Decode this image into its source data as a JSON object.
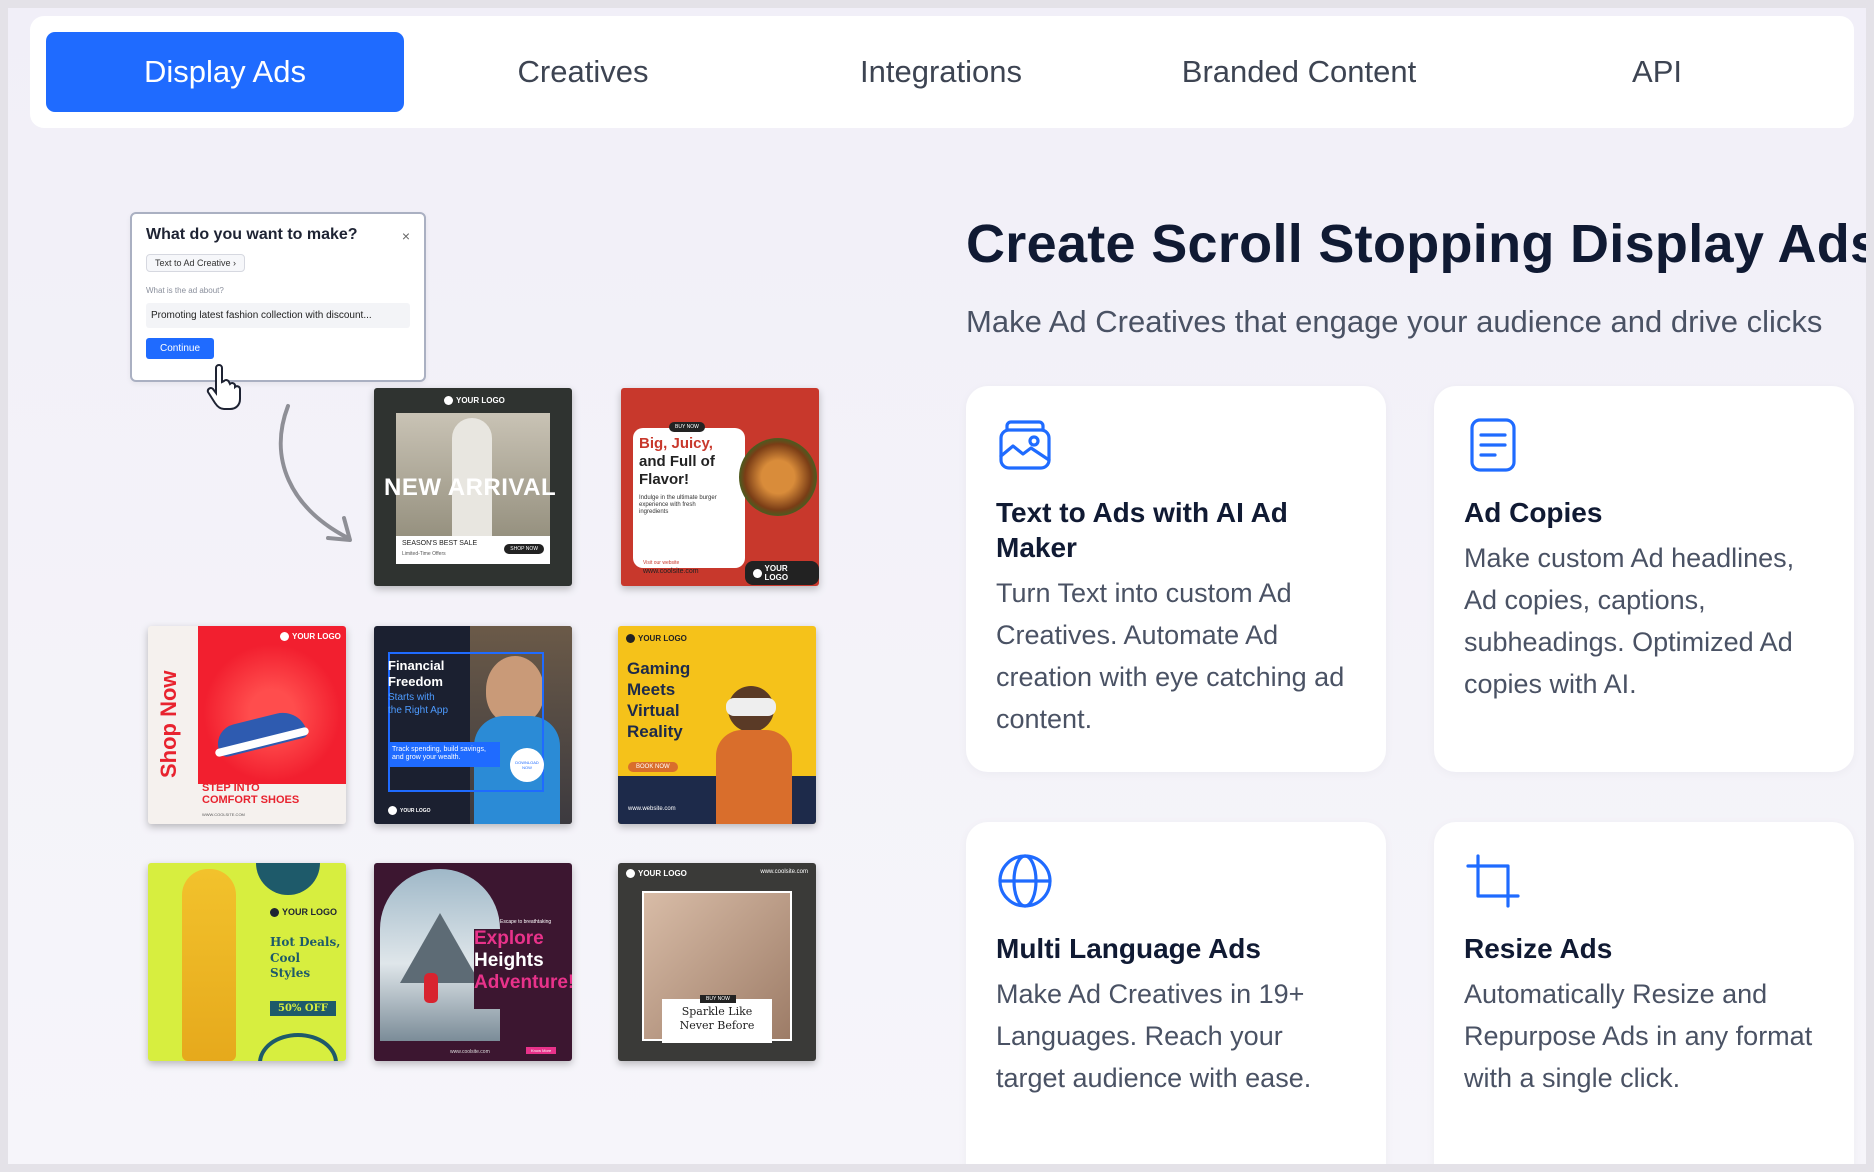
{
  "tabs": [
    {
      "label": "Display Ads",
      "active": true
    },
    {
      "label": "Creatives",
      "active": false
    },
    {
      "label": "Integrations",
      "active": false
    },
    {
      "label": "Branded Content",
      "active": false
    },
    {
      "label": "API",
      "active": false
    }
  ],
  "hero": {
    "title": "Create Scroll Stopping Display Ads",
    "subtitle": "Make Ad Creatives that engage your audience and drive clicks"
  },
  "features": [
    {
      "icon": "image-card-icon",
      "title": "Text to Ads with AI Ad Maker",
      "desc": "Turn Text into custom Ad Creatives. Automate Ad creation with eye catching ad content."
    },
    {
      "icon": "document-lines-icon",
      "title": "Ad Copies",
      "desc": "Make custom Ad headlines, Ad copies, captions, subheadings. Optimized Ad copies with AI."
    },
    {
      "icon": "globe-icon",
      "title": "Multi Language Ads",
      "desc": "Make Ad Creatives in 19+ Languages. Reach your target audience with ease."
    },
    {
      "icon": "crop-icon",
      "title": "Resize Ads",
      "desc": "Automatically Resize and Repurpose Ads in any format with a single click."
    }
  ],
  "dialog": {
    "title": "What do you want to make?",
    "close": "×",
    "pill": "Text to Ad Creative ›",
    "question": "What is the ad about?",
    "answer": "Promoting latest fashion  collection with discount...",
    "continue": "Continue"
  },
  "ads": {
    "a1": {
      "logo": "YOUR LOGO",
      "headline": "NEW ARRIVAL",
      "sub1": "SEASON'S BEST SALE",
      "sub2": "Limited-Time Offers",
      "cta": "SHOP NOW"
    },
    "a2": {
      "tag": "BUY NOW",
      "headline1": "Big, Juicy,",
      "headline2": "and Full of",
      "headline3": "Flavor!",
      "body": "Indulge in the ultimate burger experience with fresh ingredients",
      "visit": "Visit our website",
      "url": "www.coolsite.com",
      "logo": "YOUR LOGO"
    },
    "a3": {
      "logo": "YOUR LOGO",
      "vertical": "Shop Now",
      "line1": "STEP INTO",
      "line2": "COMFORT SHOES",
      "url": "WWW.COOLSITE.COM"
    },
    "a4": {
      "h1": "Financial",
      "h2": "Freedom",
      "s1": "Starts with",
      "s2": "the Right App",
      "body": "Track spending, build savings, and grow your wealth.",
      "badge": "DOWNLOAD NOW",
      "logo": "YOUR LOGO"
    },
    "a5": {
      "logo": "YOUR LOGO",
      "h1": "Gaming",
      "h2": "Meets",
      "h3": "Virtual",
      "h4": "Reality",
      "cta": "BOOK NOW",
      "url": "www.website.com"
    },
    "a6": {
      "logo": "YOUR LOGO",
      "h1": "Hot Deals,",
      "h2": "Cool",
      "h3": "Styles",
      "offer": "50% OFF"
    },
    "a7": {
      "kicker": "Escape to breathtaking",
      "h1": "Explore",
      "h2": "Heights",
      "h3": "Adventure!",
      "url": "www.coolsite.com",
      "cta": "Know More"
    },
    "a8": {
      "logo": "YOUR LOGO",
      "url": "www.coolsite.com",
      "tag": "BUY NOW",
      "h1": "Sparkle Like",
      "h2": "Never Before"
    }
  },
  "colors": {
    "accent": "#1f6bff",
    "heading": "#101a33",
    "body": "#4a5264"
  }
}
